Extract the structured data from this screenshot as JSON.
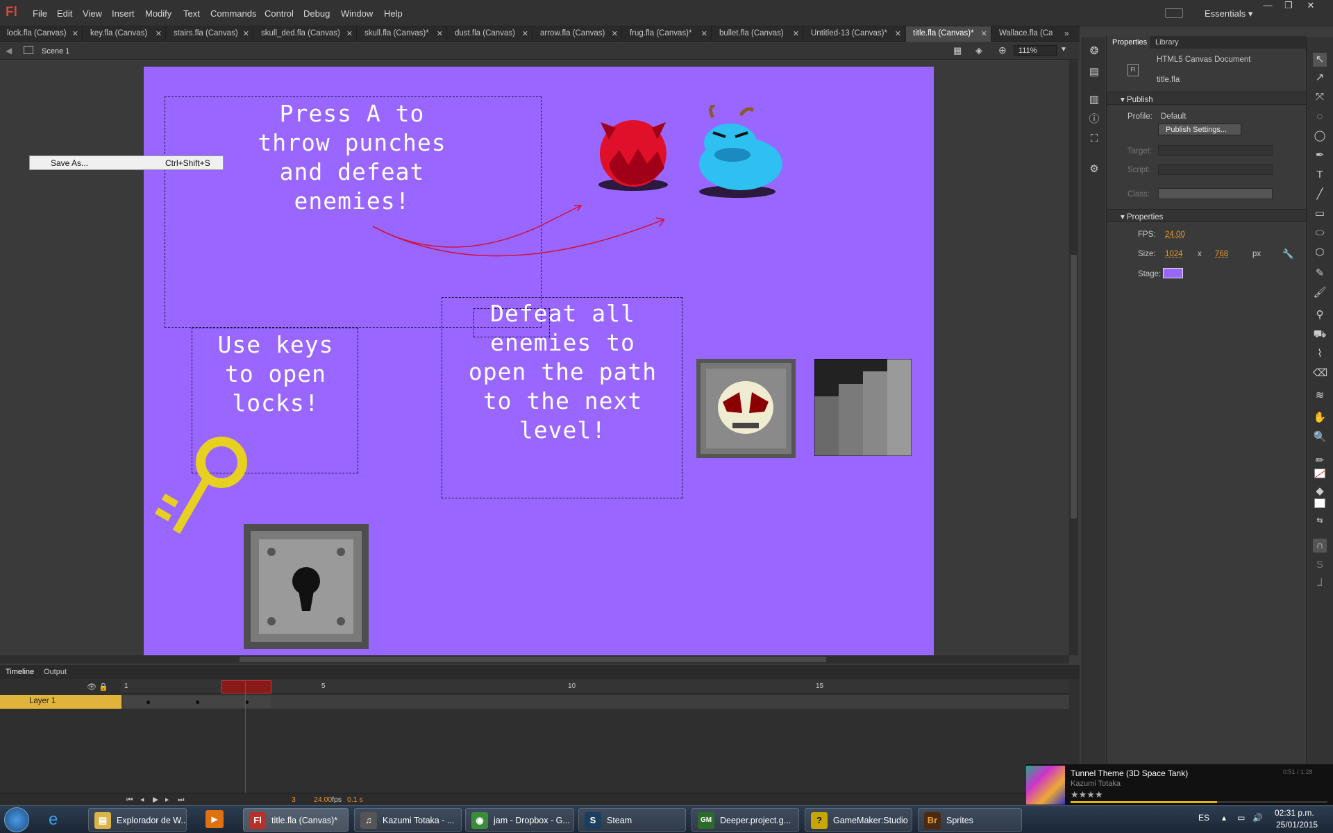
{
  "app": {
    "logo": "Fl"
  },
  "menu": [
    "File",
    "Edit",
    "View",
    "Insert",
    "Modify",
    "Text",
    "Commands",
    "Control",
    "Debug",
    "Window",
    "Help"
  ],
  "workspace": "Essentials",
  "window_controls": [
    "—",
    "❐",
    "✕"
  ],
  "tabs": [
    {
      "label": "lock.fla (Canvas)",
      "active": false
    },
    {
      "label": "key.fla (Canvas)",
      "active": false
    },
    {
      "label": "stairs.fla (Canvas)",
      "active": false
    },
    {
      "label": "skull_ded.fla (Canvas)",
      "active": false
    },
    {
      "label": "skull.fla (Canvas)*",
      "active": false
    },
    {
      "label": "dust.fla (Canvas)",
      "active": false
    },
    {
      "label": "arrow.fla (Canvas)",
      "active": false
    },
    {
      "label": "frug.fla (Canvas)*",
      "active": false
    },
    {
      "label": "bullet.fla (Canvas)",
      "active": false
    },
    {
      "label": "Untitled-13 (Canvas)*",
      "active": false
    },
    {
      "label": "title.fla (Canvas)*",
      "active": true
    },
    {
      "label": "Wallace.fla (Ca",
      "active": false
    }
  ],
  "editbar": {
    "scene": "Scene 1",
    "zoom": "111%"
  },
  "context_menu": {
    "item": "Save As...",
    "shortcut": "Ctrl+Shift+S"
  },
  "stage": {
    "color": "#9966ff",
    "text_punch": "Press A to\nthrow punches\nand defeat\nenemies!",
    "text_keys": "Use keys\nto open\nlocks!",
    "text_defeat": "Defeat all\nenemies to\nopen the path\nto the next\nlevel!"
  },
  "timeline": {
    "tabs": [
      "Timeline",
      "Output"
    ],
    "layer": "Layer 1",
    "ruler": [
      "1",
      "5",
      "10",
      "15"
    ],
    "current_frame": "3",
    "fps": "24.00",
    "fps_unit": "fps",
    "time": "0.1 s"
  },
  "properties": {
    "tabs": [
      "Properties",
      "Library"
    ],
    "doc_type": "HTML5 Canvas Document",
    "doc_name": "title.fla",
    "publish_head": "Publish",
    "profile_label": "Profile:",
    "profile_value": "Default",
    "publish_settings": "Publish Settings...",
    "target_label": "Target:",
    "script_label": "Script:",
    "class_label": "Class:",
    "props_head": "Properties",
    "fps_label": "FPS:",
    "fps_value": "24.00",
    "size_label": "Size:",
    "width": "1024",
    "x": "x",
    "height": "768",
    "unit": "px",
    "stage_label": "Stage:",
    "stage_color": "#9966ff"
  },
  "now_playing": {
    "title": "Tunnel Theme (3D Space Tank)",
    "artist": "Kazumi Totaka",
    "time": "0:51 / 1:28",
    "rating": "★★★★"
  },
  "taskbar": {
    "buttons": [
      {
        "label": "Explorador de W...",
        "icon": "📁",
        "color": "#d9b44a"
      },
      {
        "label": "title.fla (Canvas)*",
        "icon": "Fl",
        "color": "#b7302a",
        "active": true
      },
      {
        "label": "Kazumi Totaka - ...",
        "icon": "♫",
        "color": "#555"
      },
      {
        "label": "jam - Dropbox - G...",
        "icon": "◉",
        "color": "#3a8c3a"
      },
      {
        "label": "Steam",
        "icon": "S",
        "color": "#1b3d5e"
      },
      {
        "label": "Deeper.project.g...",
        "icon": "GM",
        "color": "#2d6b2d"
      },
      {
        "label": "GameMaker:Studio",
        "icon": "?",
        "color": "#c7a600"
      },
      {
        "label": "Sprites",
        "icon": "Br",
        "color": "#4a2a10"
      }
    ],
    "lang": "ES",
    "time": "02:31 p.m.",
    "date": "25/01/2015"
  }
}
